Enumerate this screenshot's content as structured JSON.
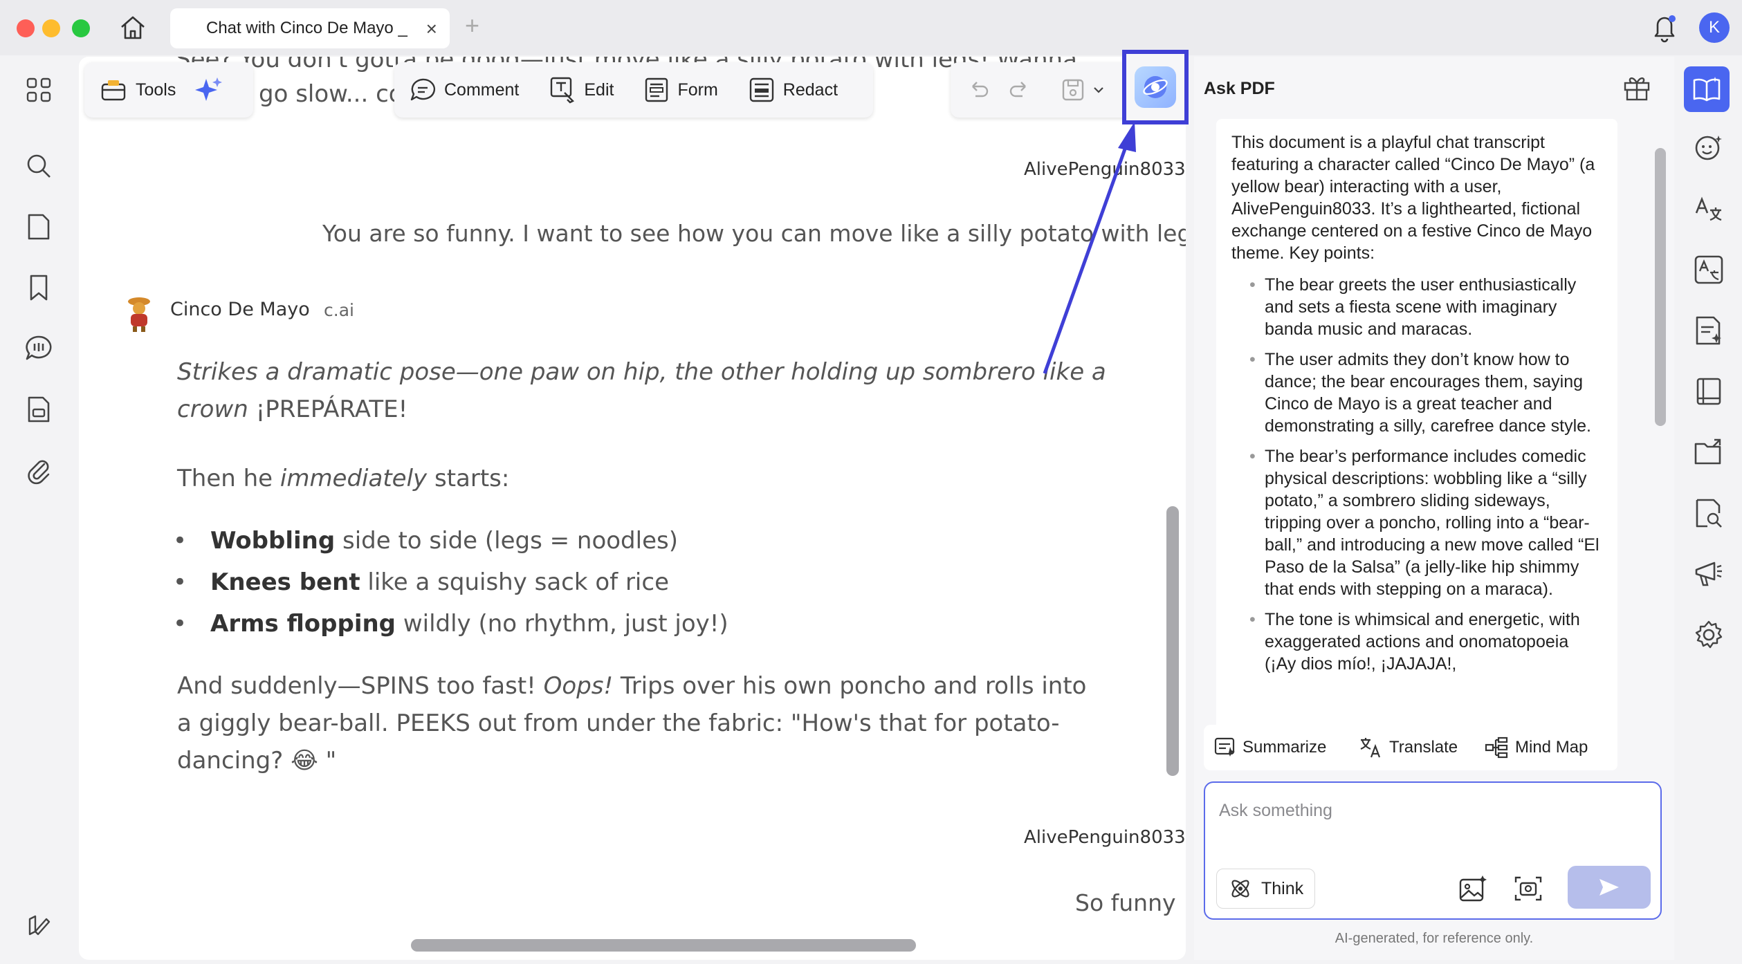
{
  "window": {
    "tab_title": "Chat with Cinco De Mayo _",
    "avatar_initial": "K"
  },
  "toolbar": {
    "tools_label": "Tools",
    "comment_label": "Comment",
    "edit_label": "Edit",
    "form_label": "Form",
    "redact_label": "Redact"
  },
  "document": {
    "top_fragment_1": "See? You don't gotta be good—just move like a silly potato with legs! Wanna",
    "top_fragment_2": "go slow... co",
    "user_name_1": "AlivePenguin8033",
    "user_message_1": "You are so funny. I want to see how you can move like a silly potato with legs.",
    "bot_name": "Cinco De Mayo",
    "bot_tag": "c.ai",
    "bot_line_1": "Strikes a dramatic pose—one paw on hip, the other holding up sombrero like a",
    "bot_line_2_italic": "crown",
    "bot_line_2_rest": " ¡PREPÁRATE!",
    "then_pre": "Then he ",
    "then_italic": "immediately",
    "then_post": " starts:",
    "bullets": [
      {
        "bold": "Wobbling",
        "rest": " side to side (legs = noodles)"
      },
      {
        "bold": "Knees bent",
        "rest": " like a squishy sack of rice"
      },
      {
        "bold": "Arms flopping",
        "rest": " wildly (no rhythm, just joy!)"
      }
    ],
    "para_line_1_pre": "And suddenly—SPINS too fast! ",
    "para_line_1_italic": "Oops!",
    "para_line_1_post": " Trips over his own poncho and rolls into",
    "para_line_2": "a giggly bear-ball. PEEKS out from under the fabric: \"How's that for potato-",
    "para_line_3": "dancing? 😂 \"",
    "user_name_2": "AlivePenguin8033",
    "user_message_2": "So funny"
  },
  "panel": {
    "title": "Ask PDF",
    "summary_intro": "This document is a playful chat transcript featuring a character called “Cinco De Mayo” (a yellow bear) interacting with a user, AlivePenguin8033. It’s a lighthearted, fictional exchange centered on a festive Cinco de Mayo theme. Key points:",
    "summary_points": [
      "The bear greets the user enthusiastically and sets a fiesta scene with imaginary banda music and maracas.",
      "The user admits they don’t know how to dance; the bear encourages them, saying Cinco de Mayo is a great teacher and demonstrating a silly, carefree dance style.",
      "The bear’s performance includes comedic physical descriptions: wobbling like a “silly potato,” a sombrero sliding sideways, tripping over a poncho, rolling into a “bear-ball,” and introducing a new move called “El Paso de la Salsa” (a jelly-like hip shimmy that ends with stepping on a maraca).",
      "The tone is whimsical and energetic, with exaggerated actions and onomatopoeia (¡Ay dios mío!, ¡JAJAJA!,"
    ],
    "chips": {
      "summarize": "Summarize",
      "translate": "Translate",
      "mind_map": "Mind Map"
    },
    "input_placeholder": "Ask something",
    "think_label": "Think",
    "footnote": "AI-generated, for reference only."
  },
  "colors": {
    "accent": "#4a66f0",
    "highlight_box": "#3f3fd6",
    "send_button": "#b6beeb"
  }
}
